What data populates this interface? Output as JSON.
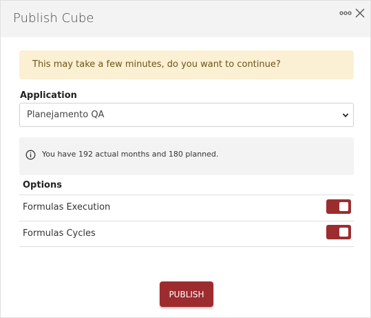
{
  "dialog": {
    "title": "Publish Cube",
    "more_icon": "more-horizontal-icon",
    "close_icon": "close-icon"
  },
  "alert": {
    "message": "This may take a few minutes, do you want to continue?"
  },
  "application": {
    "label": "Application",
    "selected": "Planejamento QA"
  },
  "info": {
    "icon": "info-icon",
    "message": "You have 192 actual months and 180 planned."
  },
  "options": {
    "label": "Options",
    "items": [
      {
        "label": "Formulas Execution",
        "enabled": true
      },
      {
        "label": "Formulas Cycles",
        "enabled": true
      }
    ]
  },
  "actions": {
    "publish_label": "PUBLISH"
  },
  "colors": {
    "accent": "#9d2c2f",
    "alert_bg": "#fbf0d3",
    "alert_text": "#6b5416",
    "header_bg": "#f3f3f3"
  }
}
